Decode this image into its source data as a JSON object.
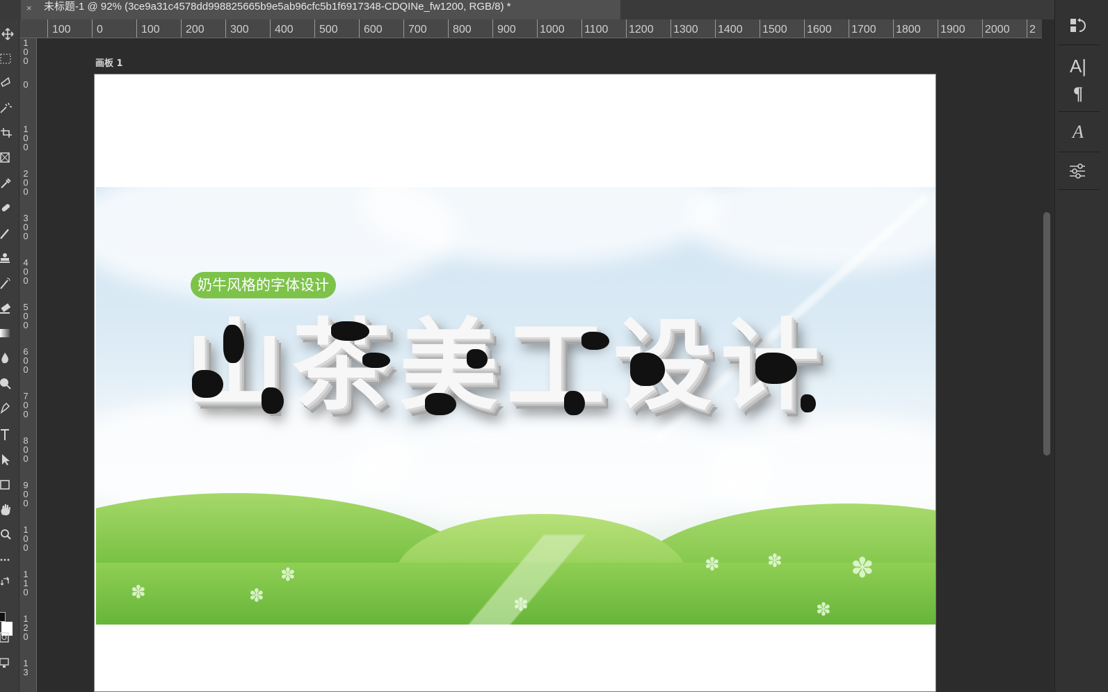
{
  "document_tab": {
    "close_glyph": "×",
    "title": "未标题-1 @ 92% (3ce9a31c4578dd998825665b9e5ab96cfc5b1f6917348-CDQINe_fw1200, RGB/8) *"
  },
  "ruler_horizontal": [
    "100",
    "0",
    "100",
    "200",
    "300",
    "400",
    "500",
    "600",
    "700",
    "800",
    "900",
    "1000",
    "1100",
    "1200",
    "1300",
    "1400",
    "1500",
    "1600",
    "1700",
    "1800",
    "1900",
    "2000",
    "2"
  ],
  "ruler_vertical": [
    "1\n0\n0",
    "0",
    "1\n0\n0",
    "2\n0\n0",
    "3\n0\n0",
    "4\n0\n0",
    "5\n0\n0",
    "6\n0\n0",
    "7\n0\n0",
    "8\n0\n0",
    "9\n0\n0",
    "1\n0\n0",
    "1\n1\n0",
    "1\n2\n0",
    "1\n3"
  ],
  "artboard": {
    "label": "画板 1",
    "pill_text": "奶牛风格的字体设计",
    "headline": "山茶美工设计"
  },
  "right_panel": {
    "type_tool_glyph": "A|",
    "paragraph_glyph": "¶",
    "glyphs_glyph": "A"
  },
  "colors": {
    "pill": "#7dc34a",
    "ui_dark": "#2c2c2c",
    "panel": "#323232"
  },
  "icons": [
    "move-icon",
    "marquee-icon",
    "lasso-icon",
    "quick-select-icon",
    "crop-icon",
    "frame-icon",
    "eyedropper-icon",
    "healing-icon",
    "brush-icon",
    "stamp-icon",
    "history-brush-icon",
    "eraser-icon",
    "gradient-icon",
    "blur-icon",
    "dodge-icon",
    "pen-icon",
    "type-icon",
    "path-select-icon",
    "rectangle-icon",
    "hand-icon",
    "zoom-icon",
    "more-icon",
    "swap-icon",
    "quick-mask-icon",
    "screen-mode-icon"
  ]
}
